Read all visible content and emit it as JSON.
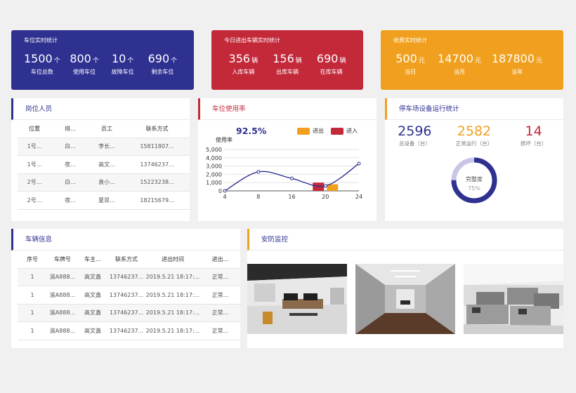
{
  "parking_stats": {
    "title": "车位实时统计",
    "items": [
      {
        "value": "1500",
        "unit": "个",
        "label": "车位总数"
      },
      {
        "value": "800",
        "unit": "个",
        "label": "使用车位"
      },
      {
        "value": "10",
        "unit": "个",
        "label": "故障车位"
      },
      {
        "value": "690",
        "unit": "个",
        "label": "剩余车位"
      }
    ],
    "color": "#2f3191"
  },
  "vehicle_stats": {
    "title": "今日进出车辆实时统计",
    "items": [
      {
        "value": "356",
        "unit": "辆",
        "label": "入库车辆"
      },
      {
        "value": "156",
        "unit": "辆",
        "label": "出库车辆"
      },
      {
        "value": "690",
        "unit": "辆",
        "label": "在库车辆"
      }
    ],
    "color": "#c4293a"
  },
  "revenue_stats": {
    "title": "收费实时统计",
    "items": [
      {
        "value": "500",
        "unit": "元",
        "label": "当日"
      },
      {
        "value": "14700",
        "unit": "元",
        "label": "当月"
      },
      {
        "value": "187800",
        "unit": "元",
        "label": "当年"
      }
    ],
    "color": "#f0a01e"
  },
  "staff": {
    "title": "岗位人员",
    "columns": [
      "位置",
      "排...",
      "员工",
      "联系方式"
    ],
    "rows": [
      [
        "1号...",
        "白...",
        "李长...",
        "15811807..."
      ],
      [
        "1号...",
        "夜...",
        "高文...",
        "13746237..."
      ],
      [
        "2号...",
        "白...",
        "袁小...",
        "15223238..."
      ],
      [
        "2号...",
        "夜...",
        "夏思...",
        "18215679..."
      ]
    ]
  },
  "usage": {
    "title": "车位使用率",
    "rate": "92.5%",
    "legend_in": "进出",
    "legend_enter": "进入",
    "colors": {
      "line": "#2f3191",
      "in_out": "#f0a01e",
      "enter": "#c4293a"
    }
  },
  "chart_data": {
    "type": "line",
    "ylabel": "使用率",
    "ylim": [
      0,
      5000
    ],
    "yticks": [
      "5,000",
      "4,000",
      "3,000",
      "2,000",
      "1,000",
      "0"
    ],
    "xticks": [
      "4",
      "8",
      "16",
      "20",
      "24"
    ],
    "line_series": {
      "x": [
        4,
        8,
        16,
        20,
        24
      ],
      "values": [
        0,
        2300,
        1500,
        600,
        3300
      ]
    },
    "series": [
      {
        "name": "进出",
        "x": [
          20
        ],
        "values": [
          800
        ]
      },
      {
        "name": "进入",
        "x": [
          20
        ],
        "values": [
          1000
        ]
      }
    ]
  },
  "devices": {
    "title": "停车场设备运行统计",
    "items": [
      {
        "value": "2596",
        "label": "总设备（台）",
        "color": "#2f3191"
      },
      {
        "value": "2582",
        "label": "正常运行（台）",
        "color": "#f0a01e"
      },
      {
        "value": "14",
        "label": "损坏（台）",
        "color": "#c4293a"
      }
    ],
    "gauge_label": "完整度",
    "gauge_value": "75%",
    "gauge_fraction": 0.75
  },
  "vehicles": {
    "title": "车辆信息",
    "columns": [
      "序号",
      "车牌号",
      "车主...",
      "联系方式",
      "进出时间",
      "进出..."
    ],
    "rows": [
      [
        "1",
        "渝A888...",
        "高文鑫",
        "13746237...",
        "2019.5.21 18:17:...",
        "正常..."
      ],
      [
        "1",
        "渝A888...",
        "高文鑫",
        "13746237...",
        "2019.5.21 18:17:...",
        "正常..."
      ],
      [
        "1",
        "渝A888...",
        "高文鑫",
        "13746237...",
        "2019.5.21 18:17:...",
        "正常..."
      ],
      [
        "1",
        "渝A888...",
        "高文鑫",
        "13746237...",
        "2019.5.21 18:17:...",
        "正常..."
      ]
    ]
  },
  "security": {
    "title": "安防监控",
    "cameras": [
      "camera-feed-1",
      "camera-feed-2",
      "camera-feed-3"
    ]
  }
}
